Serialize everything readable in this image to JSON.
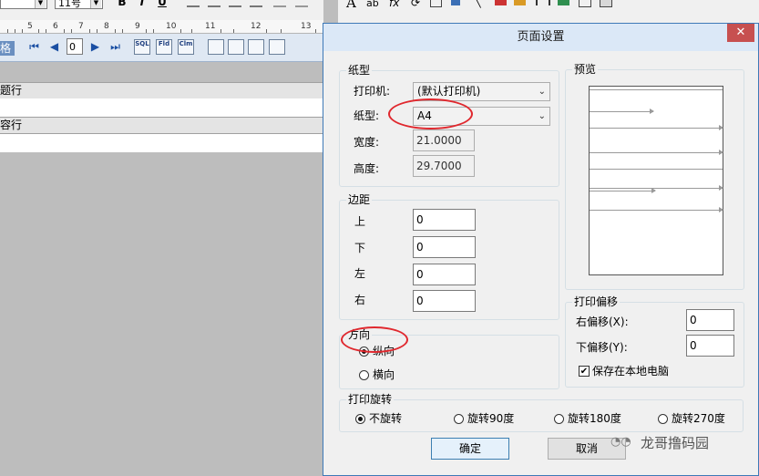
{
  "editor": {
    "font_size_value": "11号",
    "bold_label": "B",
    "italic_label": "I",
    "underline_label": "U",
    "ruler_numbers": [
      "5",
      "6",
      "7",
      "8",
      "9",
      "10",
      "11",
      "12",
      "13"
    ],
    "nav_label": "格",
    "nav_page_value": "0",
    "nav_tool_labels": [
      "SQL",
      "Fld",
      "Clm"
    ],
    "band1_label": "题行",
    "band2_label": "容行"
  },
  "dialog": {
    "title": "页面设置",
    "close_icon": "✕",
    "paper_group": {
      "label": "纸型",
      "printer_label": "打印机:",
      "printer_value": "(默认打印机)",
      "paper_label": "纸型:",
      "paper_value": "A4",
      "width_label": "宽度:",
      "width_value": "21.0000",
      "height_label": "高度:",
      "height_value": "29.7000"
    },
    "margin_group": {
      "label": "边距",
      "top_label": "上",
      "top_value": "0",
      "bottom_label": "下",
      "bottom_value": "0",
      "left_label": "左",
      "left_value": "0",
      "right_label": "右",
      "right_value": "0"
    },
    "orientation_group": {
      "label": "方向",
      "portrait_label": "纵向",
      "landscape_label": "横向",
      "selected": "portrait"
    },
    "preview_group": {
      "label": "预览"
    },
    "offset_group": {
      "label": "打印偏移",
      "right_offset_label": "右偏移(X):",
      "right_offset_value": "0",
      "down_offset_label": "下偏移(Y):",
      "down_offset_value": "0",
      "save_local_label": "保存在本地电脑",
      "save_local_checked": true
    },
    "rotation_group": {
      "label": "打印旋转",
      "options": [
        "不旋转",
        "旋转90度",
        "旋转180度",
        "旋转270度"
      ],
      "selected": "不旋转"
    },
    "ok_label": "确定",
    "cancel_label": "取消"
  },
  "watermark": {
    "text": "龙哥撸码园"
  },
  "colors": {
    "highlight_oval": "#e0282e",
    "title_bar": "#dbe8f7",
    "close_button": "#c75050"
  }
}
